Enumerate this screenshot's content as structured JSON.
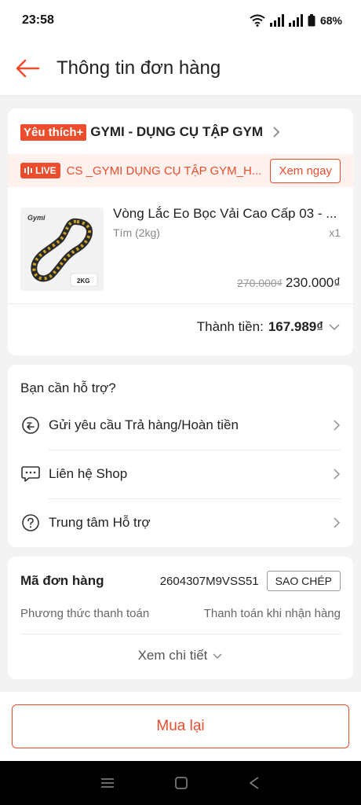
{
  "status_bar": {
    "time": "23:58",
    "battery": "68%"
  },
  "header": {
    "title": "Thông tin đơn hàng"
  },
  "shop": {
    "badge": "Yêu thích+",
    "name": "GYMI - DỤNG CỤ TẬP GYM",
    "live_label": "LIVE",
    "live_text": "CS _GYMI DỤNG CỤ TẬP GYM_H...",
    "watch_label": "Xem ngay"
  },
  "product": {
    "name": "Vòng Lắc Eo Bọc Vải Cao Cấp 03 - ...",
    "variant": "Tím (2kg)",
    "quantity": "x1",
    "old_price": "270.000₫",
    "price": "230.000₫",
    "image_brand": "Gymi",
    "image_weight": "2KG"
  },
  "total": {
    "label": "Thành tiền:",
    "value": "167.989₫"
  },
  "help": {
    "title": "Bạn cần hỗ trợ?",
    "items": [
      {
        "label": "Gửi yêu cầu Trả hàng/Hoàn tiền",
        "icon": "return-icon"
      },
      {
        "label": "Liên hệ Shop",
        "icon": "chat-icon"
      },
      {
        "label": "Trung tâm Hỗ trợ",
        "icon": "help-icon"
      }
    ]
  },
  "order": {
    "id_label": "Mã đơn hàng",
    "id_value": "2604307M9VSS51",
    "copy_label": "SAO CHÉP",
    "payment_label": "Phương thức thanh toán",
    "payment_value": "Thanh toán khi nhận hàng",
    "more_label": "Xem chi tiết"
  },
  "footer": {
    "rebuy_label": "Mua lại"
  },
  "colors": {
    "accent": "#ee4d2d"
  }
}
